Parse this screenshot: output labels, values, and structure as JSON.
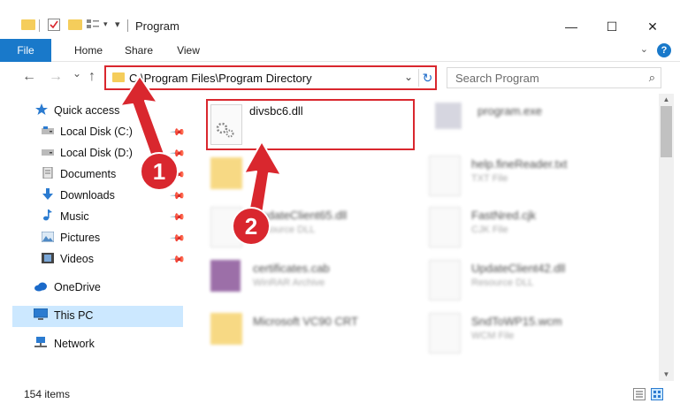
{
  "window": {
    "title": "Program",
    "minimize": "—",
    "maximize": "☐",
    "close": "✕"
  },
  "ribbon": {
    "tabs": [
      "File",
      "Home",
      "Share",
      "View"
    ],
    "help": "?"
  },
  "nav": {
    "back": "←",
    "forward": "→",
    "recent": "⌄",
    "up": "↑",
    "address": "C:\\Program Files\\Program Directory",
    "search_placeholder": "Search Program"
  },
  "sidebar": {
    "items": [
      {
        "label": "Quick access",
        "icon": "star-icon"
      },
      {
        "label": "Local Disk (C:)",
        "icon": "drive-icon",
        "pinned": true
      },
      {
        "label": "Local Disk (D:)",
        "icon": "drive-icon",
        "pinned": true
      },
      {
        "label": "Documents",
        "icon": "documents-icon",
        "pinned": true
      },
      {
        "label": "Downloads",
        "icon": "download-icon",
        "pinned": true
      },
      {
        "label": "Music",
        "icon": "music-icon",
        "pinned": true
      },
      {
        "label": "Pictures",
        "icon": "pictures-icon",
        "pinned": true
      },
      {
        "label": "Videos",
        "icon": "videos-icon",
        "pinned": true
      },
      {
        "label": "OneDrive",
        "icon": "cloud-icon"
      },
      {
        "label": "This PC",
        "icon": "monitor-icon",
        "selected": true
      },
      {
        "label": "Network",
        "icon": "network-icon"
      }
    ]
  },
  "files": [
    {
      "name": "divsbc6.dll",
      "type": ""
    },
    {
      "name": "program.exe",
      "type": ""
    },
    {
      "name": "",
      "type": ""
    },
    {
      "name": "help.fineReader.txt",
      "type": "TXT File"
    },
    {
      "name": "UpdateClient65.dll",
      "type": "Resource DLL"
    },
    {
      "name": "FastNred.cjk",
      "type": "CJK File"
    },
    {
      "name": "certificates.cab",
      "type": "WinRAR Archive"
    },
    {
      "name": "UpdateClient42.dll",
      "type": "Resource DLL"
    },
    {
      "name": "Microsoft VC90 CRT",
      "type": ""
    },
    {
      "name": "SndToWP15.wcm",
      "type": "WCM File"
    }
  ],
  "status": {
    "items": "154 items"
  },
  "annotations": {
    "step1": "1",
    "step2": "2",
    "color": "#d9272e"
  },
  "colors": {
    "accent": "#1979ca",
    "selected": "#cce8ff",
    "folder": "#f5cd5b"
  }
}
